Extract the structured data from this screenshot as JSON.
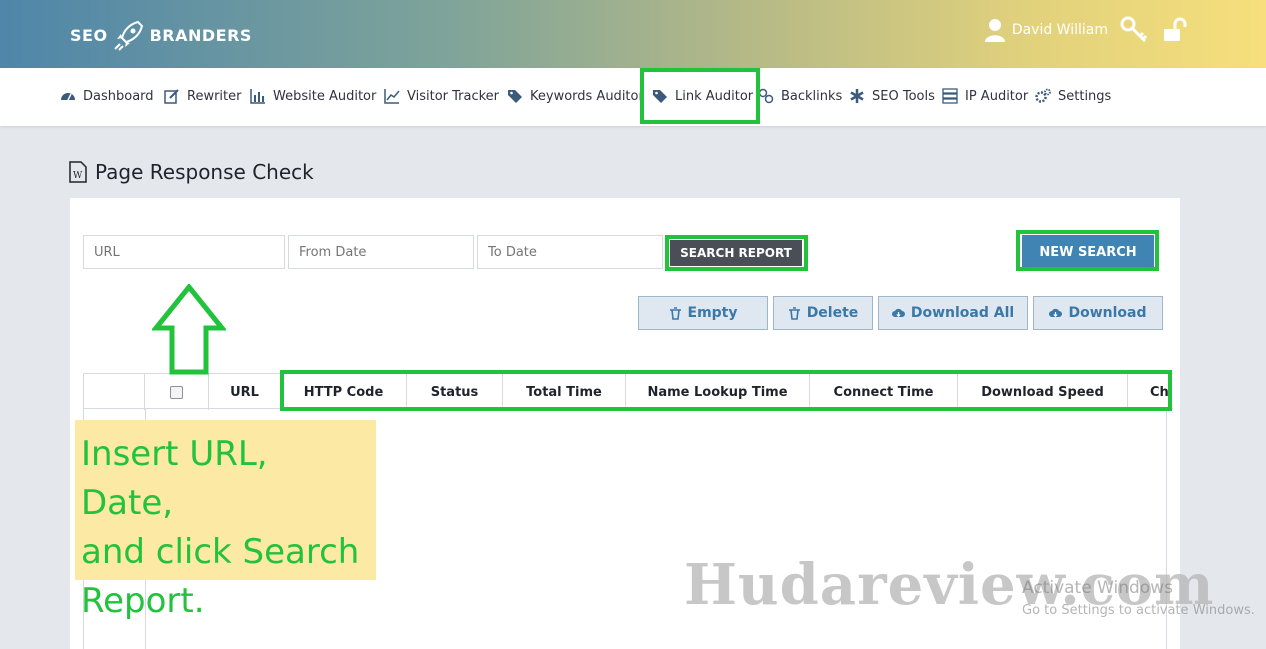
{
  "header": {
    "logo_left": "SEO",
    "logo_right": "BRANDERS",
    "user_name": "David William",
    "gradient_colors": [
      "#4f86a9",
      "#f6df7c"
    ]
  },
  "nav": {
    "items": [
      {
        "label": "Dashboard",
        "icon": "dashboard-icon"
      },
      {
        "label": "Rewriter",
        "icon": "edit-icon"
      },
      {
        "label": "Website Auditor",
        "icon": "bar-chart-icon"
      },
      {
        "label": "Visitor Tracker",
        "icon": "line-chart-icon"
      },
      {
        "label": "Keywords Auditor",
        "icon": "tags-icon"
      },
      {
        "label": "Link Auditor",
        "icon": "tag-icon"
      },
      {
        "label": "Backlinks",
        "icon": "link-icon"
      },
      {
        "label": "SEO Tools",
        "icon": "asterisk-icon"
      },
      {
        "label": "IP Auditor",
        "icon": "server-icon"
      },
      {
        "label": "Settings",
        "icon": "cogs-icon"
      }
    ],
    "highlighted": "Link Auditor"
  },
  "page": {
    "title": "Page Response Check"
  },
  "search": {
    "url_placeholder": "URL",
    "from_placeholder": "From Date",
    "to_placeholder": "To Date",
    "search_button": "SEARCH REPORT",
    "new_search_button": "NEW SEARCH"
  },
  "actions": {
    "empty": "Empty",
    "delete": "Delete",
    "download_all": "Download All",
    "download": "Download"
  },
  "table": {
    "columns": [
      "URL",
      "HTTP Code",
      "Status",
      "Total Time",
      "Name Lookup Time",
      "Connect Time",
      "Download Speed",
      "Ch"
    ]
  },
  "annotation": {
    "line1": "Insert URL, Date,",
    "line2": "and click Search",
    "line3": "Report.",
    "highlight_color": "#22c23d",
    "note_bg": "#fbe9a4"
  },
  "overlay": {
    "watermark": "Hudareview.com",
    "activate_title": "Activate Windows",
    "activate_sub": "Go to Settings to activate Windows."
  },
  "colors": {
    "accent_blue": "#3f84b3",
    "dark_button": "#4a4e56",
    "page_bg": "#e4e7ec"
  }
}
